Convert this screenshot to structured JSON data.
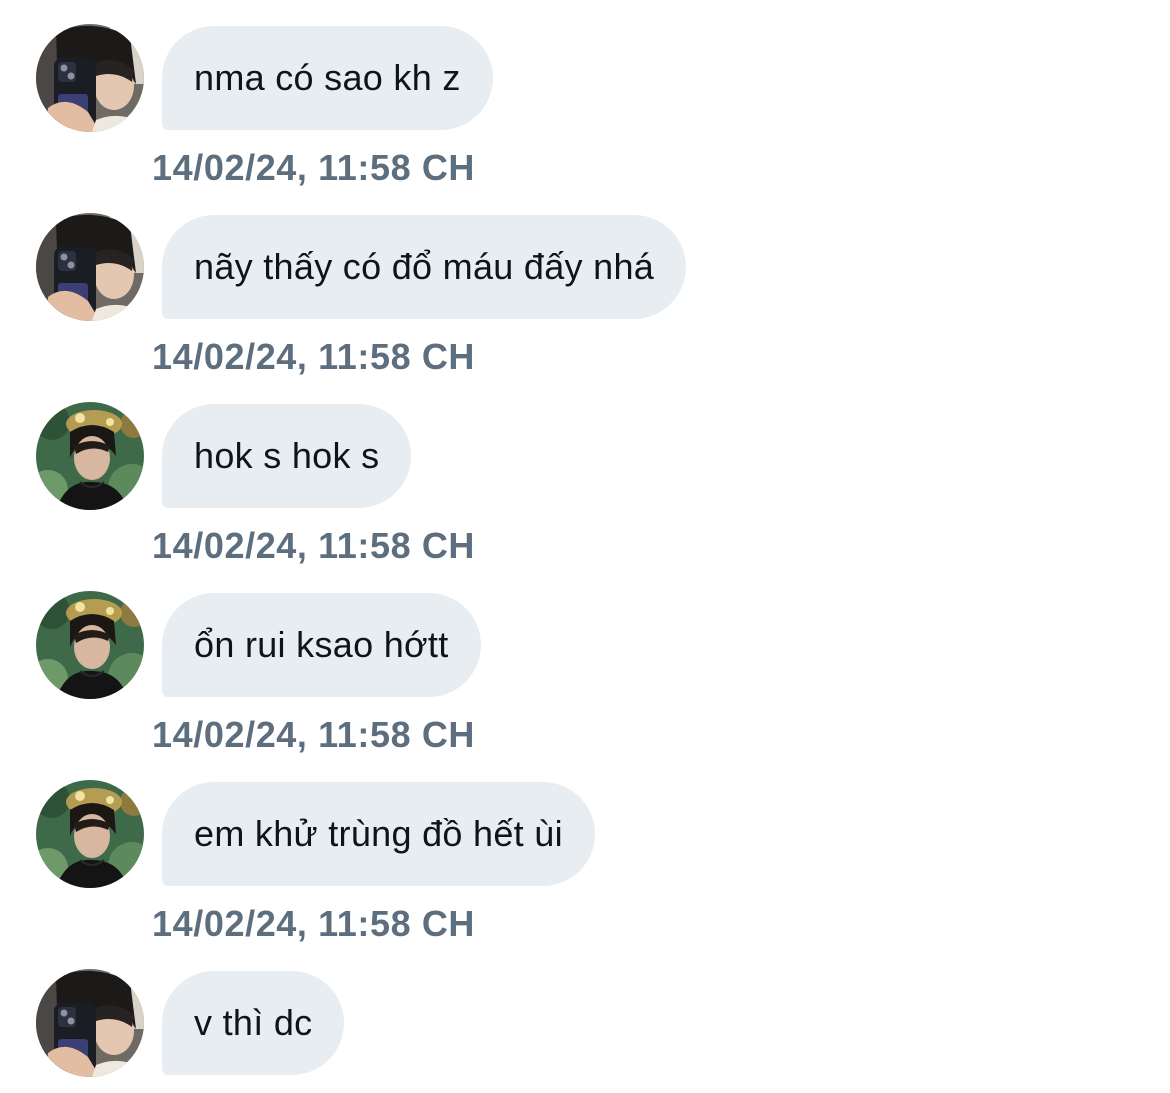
{
  "messages": [
    {
      "avatar": "girl-selfie-avatar",
      "text": "nma có sao kh z",
      "time": "14/02/24, 11:58 CH"
    },
    {
      "avatar": "girl-selfie-avatar",
      "text": "nãy thấy có đổ máu đấy nhá",
      "time": "14/02/24, 11:58 CH"
    },
    {
      "avatar": "boy-forest-avatar",
      "text": "hok s hok s",
      "time": "14/02/24, 11:58 CH"
    },
    {
      "avatar": "boy-forest-avatar",
      "text": "ổn rui ksao hớtt",
      "time": "14/02/24, 11:58 CH"
    },
    {
      "avatar": "boy-forest-avatar",
      "text": "em khử trùng đồ hết ùi",
      "time": "14/02/24, 11:58 CH"
    },
    {
      "avatar": "girl-selfie-avatar",
      "text": "v thì dc",
      "time": ""
    }
  ],
  "colors": {
    "bubble_bg": "#e8edf2",
    "message_text": "#0f1419",
    "timestamp_text": "#5d6e7f",
    "background": "#ffffff"
  }
}
